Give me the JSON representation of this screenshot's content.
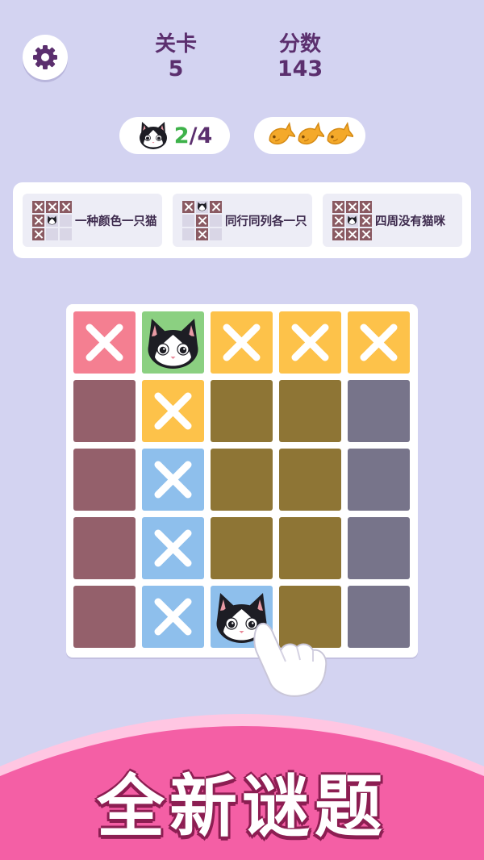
{
  "stats": {
    "level_label": "关卡",
    "level_value": "5",
    "score_label": "分数",
    "score_value": "143"
  },
  "progress": {
    "found": "2",
    "separator": "/",
    "total": "4"
  },
  "hints": {
    "count": 3,
    "icon": "goldfish-cracker-icon"
  },
  "rules": [
    {
      "text": "一种颜色一只猫",
      "pattern": [
        "x",
        "x",
        "x",
        "x",
        "c",
        "e",
        "x",
        "e",
        "e"
      ]
    },
    {
      "text": "同行同列各一只",
      "pattern": [
        "x",
        "c",
        "x",
        "e",
        "x",
        "e",
        "e",
        "x",
        "e"
      ]
    },
    {
      "text": "四周没有猫咪",
      "pattern": [
        "x",
        "x",
        "x",
        "x",
        "c",
        "x",
        "x",
        "x",
        "x"
      ]
    }
  ],
  "board": {
    "rows": [
      [
        {
          "color": "#f47f91",
          "mark": "x"
        },
        {
          "color": "#8bd081",
          "mark": "cat"
        },
        {
          "color": "#fdc24a",
          "mark": "x"
        },
        {
          "color": "#fdc24a",
          "mark": "x"
        },
        {
          "color": "#fdc24a",
          "mark": "x"
        }
      ],
      [
        {
          "color": "#94606b",
          "mark": ""
        },
        {
          "color": "#fdc24a",
          "mark": "x"
        },
        {
          "color": "#8e7535",
          "mark": ""
        },
        {
          "color": "#8e7535",
          "mark": ""
        },
        {
          "color": "#77748a",
          "mark": ""
        }
      ],
      [
        {
          "color": "#94606b",
          "mark": ""
        },
        {
          "color": "#8ebfec",
          "mark": "x"
        },
        {
          "color": "#8e7535",
          "mark": ""
        },
        {
          "color": "#8e7535",
          "mark": ""
        },
        {
          "color": "#77748a",
          "mark": ""
        }
      ],
      [
        {
          "color": "#94606b",
          "mark": ""
        },
        {
          "color": "#8ebfec",
          "mark": "x"
        },
        {
          "color": "#8e7535",
          "mark": ""
        },
        {
          "color": "#8e7535",
          "mark": ""
        },
        {
          "color": "#77748a",
          "mark": ""
        }
      ],
      [
        {
          "color": "#94606b",
          "mark": ""
        },
        {
          "color": "#8ebfec",
          "mark": "x"
        },
        {
          "color": "#8ebfec",
          "mark": "cat"
        },
        {
          "color": "#8e7535",
          "mark": ""
        },
        {
          "color": "#77748a",
          "mark": ""
        }
      ]
    ]
  },
  "banner": {
    "title": "全新谜题"
  },
  "colors": {
    "background": "#d3d3f1",
    "text": "#5b2f6e",
    "banner": "#f45fa5",
    "accent_green": "#3eb24a"
  }
}
